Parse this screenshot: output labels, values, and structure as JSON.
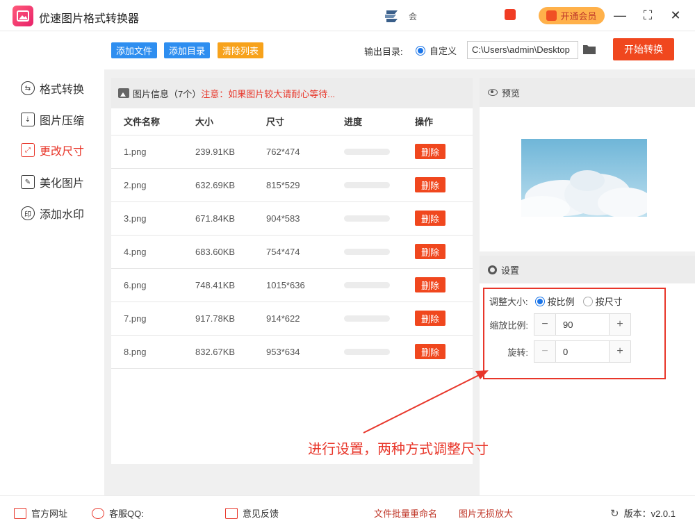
{
  "app": {
    "title": "优速图片格式转换器",
    "user_name": "会",
    "vip_label": "开通会员"
  },
  "window_controls": {
    "minimize": "—",
    "maximize": "⛶",
    "close": "✕"
  },
  "sidebar": {
    "items": [
      {
        "label": "格式转换",
        "icon": "format-convert-icon",
        "active": false
      },
      {
        "label": "图片压缩",
        "icon": "compress-icon",
        "active": false
      },
      {
        "label": "更改尺寸",
        "icon": "resize-icon",
        "active": true
      },
      {
        "label": "美化图片",
        "icon": "beautify-icon",
        "active": false
      },
      {
        "label": "添加水印",
        "icon": "watermark-icon",
        "active": false
      }
    ]
  },
  "toolbar": {
    "add_files": "添加文件",
    "add_folder": "添加目录",
    "clear_list": "清除列表",
    "output_label": "输出目录:",
    "output_option": "自定义",
    "output_path": "C:\\Users\\admin\\Desktop",
    "start": "开始转换"
  },
  "file_list": {
    "header_title": "图片信息（7个）",
    "notice": "注意：如果图片较大请耐心等待...",
    "columns": [
      "文件名称",
      "大小",
      "尺寸",
      "进度",
      "操作"
    ],
    "delete_label": "删除",
    "rows": [
      {
        "name": "1.png",
        "size": "239.91KB",
        "dims": "762*474",
        "progress": 0
      },
      {
        "name": "2.png",
        "size": "632.69KB",
        "dims": "815*529",
        "progress": 0
      },
      {
        "name": "3.png",
        "size": "671.84KB",
        "dims": "904*583",
        "progress": 0
      },
      {
        "name": "4.png",
        "size": "683.60KB",
        "dims": "754*474",
        "progress": 0
      },
      {
        "name": "6.png",
        "size": "748.41KB",
        "dims": "1015*636",
        "progress": 0
      },
      {
        "name": "7.png",
        "size": "917.78KB",
        "dims": "914*622",
        "progress": 0
      },
      {
        "name": "8.png",
        "size": "832.67KB",
        "dims": "953*634",
        "progress": 0
      }
    ]
  },
  "preview": {
    "title": "预览"
  },
  "settings": {
    "title": "设置",
    "resize_label": "调整大小:",
    "mode_ratio": "按比例",
    "mode_size": "按尺寸",
    "scale_label": "缩放比例:",
    "scale_value": "90",
    "rotate_label": "旋转:",
    "rotate_value": "0",
    "minus": "−",
    "plus": "+"
  },
  "annotation": {
    "text": "进行设置，两种方式调整尺寸"
  },
  "footer": {
    "website": "官方网址",
    "qq": "客服QQ:",
    "feedback": "意见反馈",
    "batch_rename": "文件批量重命名",
    "lossless_enlarge": "图片无损放大",
    "version_label": "版本：v2.0.1"
  },
  "colors": {
    "accent_red": "#f0471e",
    "blue_button": "#2e8ef0",
    "orange_button": "#f7a21b",
    "vip": "#ffb14a"
  }
}
